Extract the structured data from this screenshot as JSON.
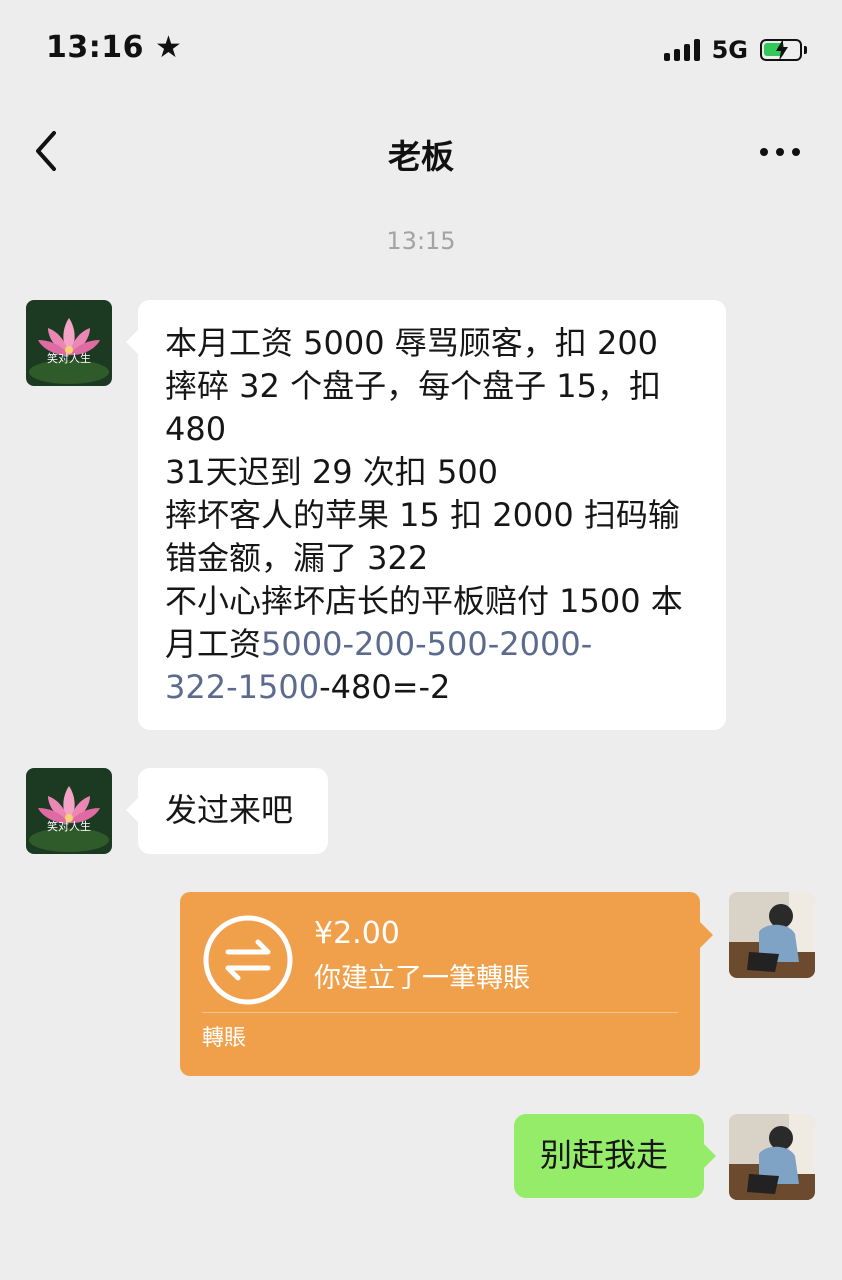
{
  "status_bar": {
    "time": "13:16 ★",
    "network": "5G",
    "battery_percent": 60
  },
  "nav": {
    "title": "老板",
    "back_icon": "chevron-left-icon",
    "more_icon": "more-horizontal-icon"
  },
  "timestamp": "13:15",
  "messages": [
    {
      "sender": "boss",
      "avatar_icon": "lotus-avatar",
      "avatar_caption": "笑对人生",
      "text_plain": "本月工资 5000 辱骂顾客，扣 200\n摔碎 32 个盘子，每个盘子 15，扣\n480\n31天迟到 29 次扣 500\n摔坏客人的苹果 15 扣 2000 扫码输\n错金额，漏了 322\n不小心摔坏店长的平板赔付 1500 本\n月工资",
      "text_link_1": "5000-200-500-2000-",
      "text_link_2": "322-1500",
      "text_tail": "-480=-2"
    },
    {
      "sender": "boss",
      "avatar_icon": "lotus-avatar",
      "avatar_caption": "笑对人生",
      "text": "发过来吧"
    },
    {
      "sender": "me",
      "type": "transfer",
      "avatar_icon": "user-photo-avatar",
      "amount": "¥2.00",
      "description": "你建立了一筆轉賬",
      "footer": "轉賬",
      "transfer_icon": "exchange-arrows-icon"
    },
    {
      "sender": "me",
      "avatar_icon": "user-photo-avatar",
      "text": "别赶我走"
    }
  ],
  "colors": {
    "background": "#ededed",
    "bubble_in": "#ffffff",
    "bubble_out": "#95ec69",
    "transfer": "#f0a04b",
    "link": "#5b6b8d"
  }
}
